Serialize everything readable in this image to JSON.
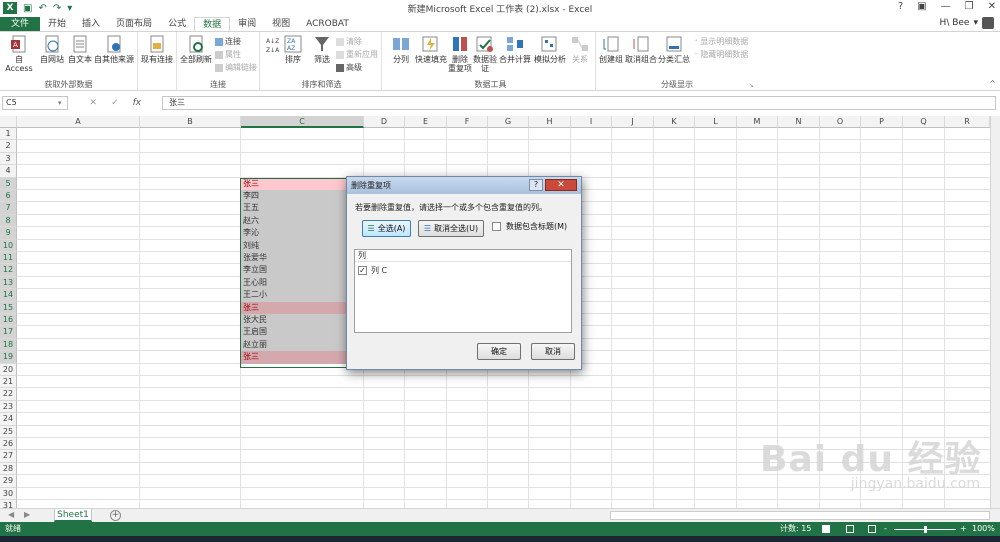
{
  "window": {
    "title": "新建Microsoft Excel 工作表 (2).xlsx - Excel",
    "help": "?",
    "app_icon": "X"
  },
  "tabs": [
    "文件",
    "开始",
    "插入",
    "页面布局",
    "公式",
    "数据",
    "审阅",
    "视图",
    "ACROBAT"
  ],
  "user": {
    "name": "H\\ Bee"
  },
  "ribbon": {
    "groups": [
      {
        "label": "获取外部数据"
      },
      {
        "label": "连接"
      },
      {
        "label": "排序和筛选"
      },
      {
        "label": "数据工具"
      },
      {
        "label": "分级显示"
      }
    ],
    "buttons": {
      "access": "自 Access",
      "web": "自网站",
      "text": "自文本",
      "other": "自其他来源",
      "existing": "现有连接",
      "refresh": "全部刷新",
      "connections": "连接",
      "properties": "属性",
      "edit_links": "编辑链接",
      "sort": "排序",
      "filter": "筛选",
      "clear": "清除",
      "reapply": "重新应用",
      "advanced": "高级",
      "text_to_col": "分列",
      "flash_fill": "快速填充",
      "remove_dup_1": "删除",
      "remove_dup_2": "重复项",
      "validation_1": "数据验",
      "validation_2": "证",
      "consolidate": "合并计算",
      "whatif": "模拟分析",
      "relations": "关系",
      "group": "创建组",
      "ungroup": "取消组合",
      "subtotal": "分类汇总",
      "show_detail": "显示明细数据",
      "hide_detail": "隐藏明细数据",
      "sort_az": "A↓Z",
      "sort_za": "Z↓A"
    }
  },
  "formula_bar": {
    "namebox": "C5",
    "value": "张三",
    "fx": "fx",
    "cancel": "✕",
    "enter": "✓"
  },
  "columns": [
    "A",
    "B",
    "C",
    "D",
    "E",
    "F",
    "G",
    "H",
    "I",
    "J",
    "K",
    "L",
    "M",
    "N",
    "O",
    "P",
    "Q",
    "R"
  ],
  "rows": [
    "1",
    "2",
    "3",
    "4",
    "5",
    "6",
    "7",
    "8",
    "9",
    "10",
    "11",
    "12",
    "13",
    "14",
    "15",
    "16",
    "17",
    "18",
    "19",
    "20",
    "21",
    "22",
    "23",
    "24",
    "25",
    "26",
    "27",
    "28",
    "29",
    "30",
    "31"
  ],
  "cells": [
    "张三",
    "李四",
    "王五",
    "赵六",
    "李沁",
    "刘纯",
    "张爱华",
    "李立国",
    "王心阳",
    "王二小",
    "张三",
    "张大民",
    "王启国",
    "赵立丽",
    "张三"
  ],
  "dialog": {
    "title": "删除重复项",
    "help": "?",
    "close": "✕",
    "message": "若要删除重复值，请选择一个或多个包含重复值的列。",
    "select_all": "全选(A)",
    "unselect_all": "取消全选(U)",
    "header_checkbox": "数据包含标题(M)",
    "list_header": "列",
    "list_item": "列 C",
    "ok": "确定",
    "cancel": "取消"
  },
  "sheet": {
    "tab": "Sheet1",
    "add": "+"
  },
  "status": {
    "ready": "就绪",
    "count": "计数: 15",
    "zoom": "100%",
    "minus": "-",
    "plus": "+"
  },
  "watermark": {
    "logo": "Bai du 经验",
    "url": "jingyan.baidu.com"
  }
}
